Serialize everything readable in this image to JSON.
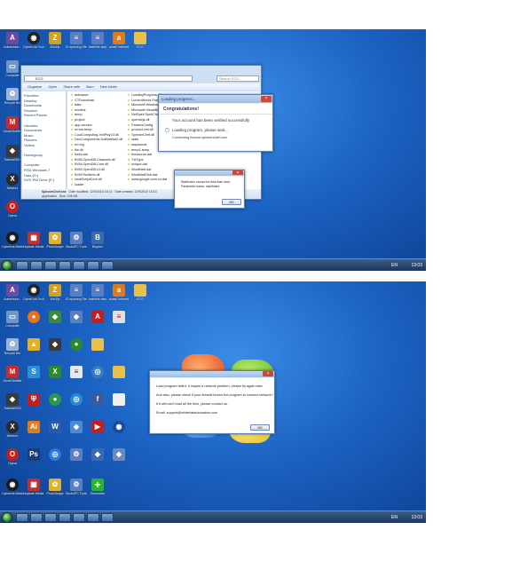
{
  "desktop": {
    "icons": [
      {
        "label": "Administra...",
        "icon": "admin-icon",
        "color": "#6b4aa0"
      },
      {
        "label": "CyberLink YouCam",
        "icon": "webcam-icon",
        "color": "#222222"
      },
      {
        "label": "WinZip",
        "icon": "winzip-icon",
        "color": "#d4a020"
      },
      {
        "label": "ID spinning Step",
        "icon": "doc-icon",
        "color": "#5a7ec0"
      },
      {
        "label": "batchfile step",
        "icon": "doc-icon",
        "color": "#5a7ec0"
      },
      {
        "label": "avast! Internet",
        "icon": "avast-icon",
        "color": "#e07a1a"
      },
      {
        "label": "ECG",
        "icon": "folder-icon",
        "color": "#e8c04a"
      },
      {
        "label": "Computer",
        "icon": "computer-icon",
        "color": "#6f96c8"
      },
      {
        "label": "Recycle Bin",
        "icon": "recycle-bin-icon",
        "color": "#9bb4d4"
      },
      {
        "label": "Gmail Notifier",
        "icon": "gmail-icon",
        "color": "#cc2a2a"
      },
      {
        "label": "TortoiseSVN",
        "icon": "tortoise-icon",
        "color": "#3a3a3a"
      },
      {
        "label": "Networx",
        "icon": "networx-icon",
        "color": "#2a2a2a"
      },
      {
        "label": "Oracle VM VirtualBox",
        "icon": "virtualbox-icon",
        "color": "#3a6ab0"
      },
      {
        "label": "Opera",
        "icon": "opera-icon",
        "color": "#c81e1e"
      },
      {
        "label": "Firefox",
        "icon": "firefox-icon",
        "color": "#e8701a"
      }
    ],
    "bottom_icons": [
      {
        "label": "Cyberlink Media Espresso",
        "icon": "media-icon",
        "color": "#1a1a1a"
      },
      {
        "label": "Dupliate Media Player",
        "icon": "media-player-icon",
        "color": "#c03030"
      },
      {
        "label": "PhotoScape",
        "icon": "photoscape-icon",
        "color": "#e0b030"
      },
      {
        "label": "StudioPC Toolkit",
        "icon": "toolkit-icon",
        "color": "#5a80c0"
      },
      {
        "label": "Beginer",
        "icon": "beginer-icon",
        "color": "#3a6ab0"
      },
      {
        "label": "TimeAdder",
        "icon": "plus-icon",
        "color": "#2bb52b"
      }
    ]
  },
  "explorer": {
    "title": "",
    "address": "ECG",
    "search_placeholder": "Search ECG",
    "toolbar": [
      "Organize",
      "Open",
      "Share with",
      "Burn",
      "New folder"
    ],
    "nav": [
      "Favorites",
      "Desktop",
      "Downloads",
      "Dropbox",
      "Recent Places",
      "",
      "Libraries",
      "Documents",
      "Music",
      "Pictures",
      "Videos",
      "",
      "Homegroup",
      "",
      "Computer",
      "RSD Windows 7",
      "Data (D:)",
      "DVD RW Drive (E:)"
    ],
    "files_col1": [
      "autosave",
      "CTDownload",
      "data",
      "models",
      "temp",
      "project",
      "app.version",
      "errors.temp",
      "CoolComputing.XmlPayV2.dll",
      "DevComponents.DotNetBar2.dll",
      "err.log",
      "file.dll",
      "fonts.dat",
      "BVM.OpenDB.Channels.dll",
      "BVM.OpenDB.Core.dll",
      "BVM.OpenDB.UI.dll",
      "BVM.Runtime.dll",
      "localScriptCore.dll",
      "loader"
    ],
    "files_col2": [
      "LoadingProgress.dll",
      "LumenWorks.Framework.IO.dll",
      "Microsoft.Windows.Forms.dll",
      "Microsoft.VisualBasic.PowerPacks.Vs.dll",
      "NetSpell.SpellChecker.dll",
      "openobjs.dll",
      "ParamsConfig",
      "product.xml.dll",
      "SpinnerChef.dll",
      "stats",
      "stopwords",
      "temp1.temp",
      "thesaurus.dat",
      "TxtType",
      "unique.dat",
      "WordNetI.dat",
      "WordNetIOsh.dat",
      "www.google.com.cn.dat"
    ],
    "status_name": "SpinnerChef.exe",
    "status_type": "Application",
    "status_modified": "Date modified: 12/9/2010 16:13",
    "status_created": "Date created: 12/9/2010 16:13",
    "status_size": "Size: 246 KB"
  },
  "loading_dialog": {
    "title": "Loading progress...",
    "heading": "Congratulations!",
    "line1": "Your account has been verified successfully",
    "line2": "Loading program, please wait...",
    "line3": "Connecting license.spinnerchief.com"
  },
  "error_dialog_1": {
    "line1": "StartIndex cannot be less than zero.",
    "line2": "Parameter name: startIndex",
    "ok": "OK"
  },
  "error_dialog_2": {
    "line1": "Load program failed, it maybe a network problem, please try again later.",
    "line2": "And also, please check if your firewall blocks the program to connect network?",
    "line3": "If it still can't load all the time, please contact us.",
    "line4": "Email: support@whitehatautomation.com",
    "ok": "OK"
  },
  "taskbar": {
    "language": "EN",
    "time": "13:03",
    "time2": "13:03"
  },
  "colors": {
    "desktop": "#1c63c4",
    "taskbar": "#1d3659"
  }
}
